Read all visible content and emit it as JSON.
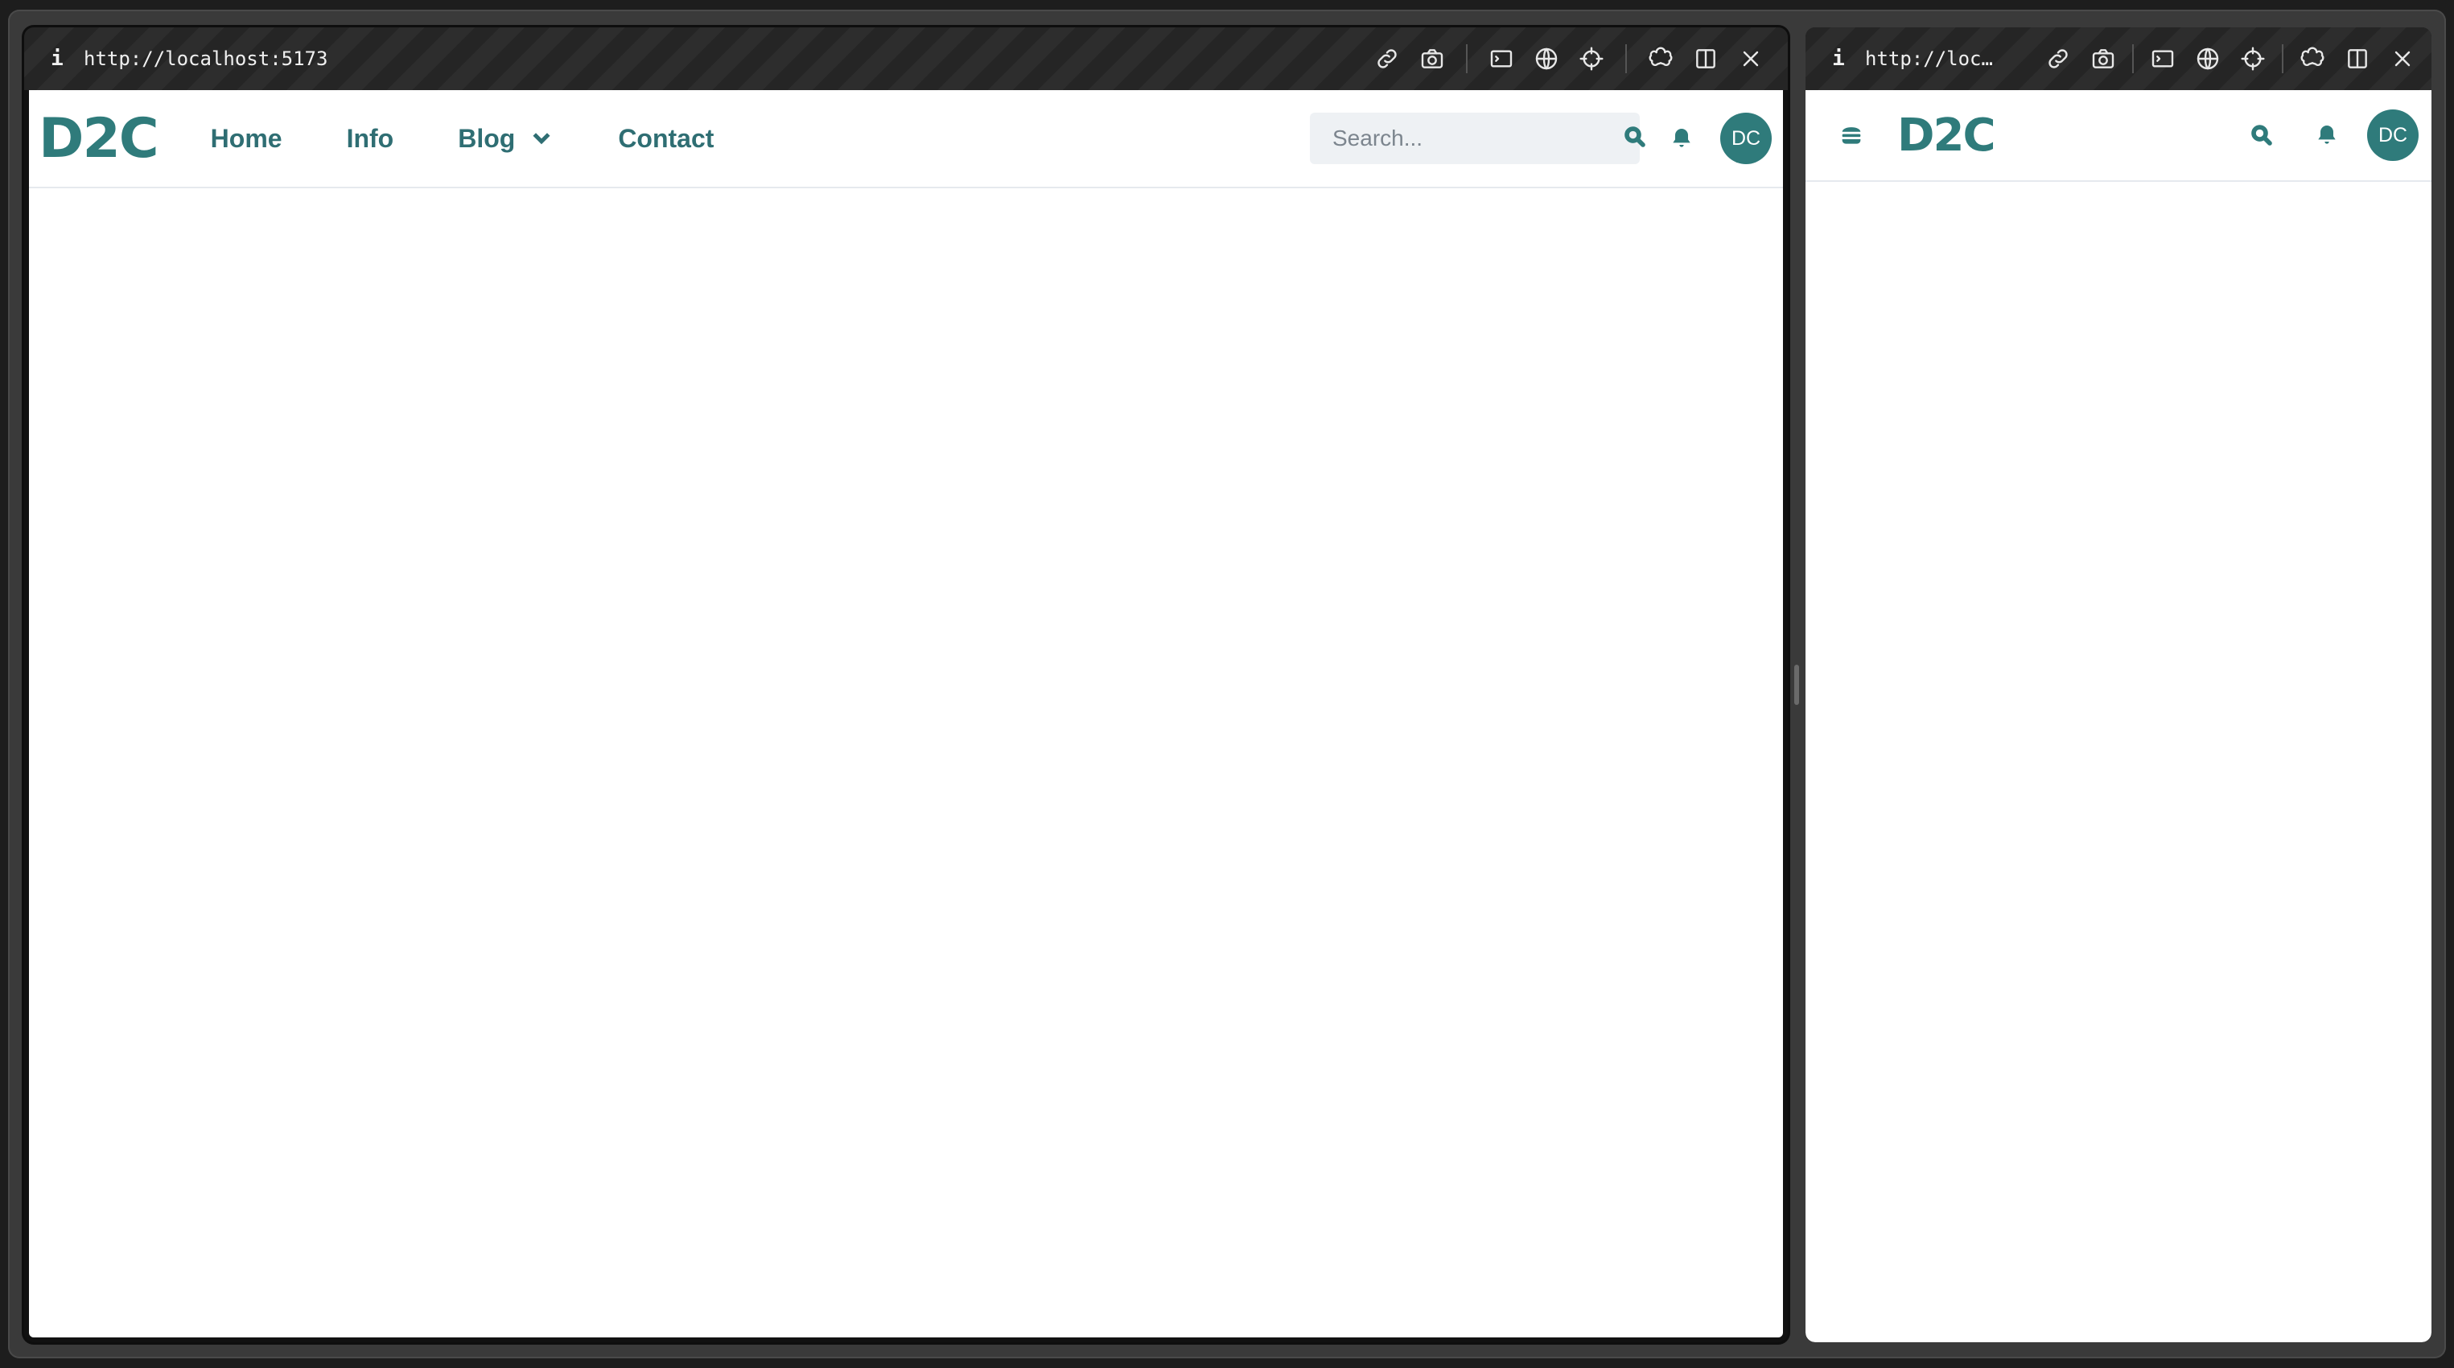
{
  "left_window": {
    "url": "http://localhost:5173",
    "logo": "D2C",
    "nav": [
      {
        "label": "Home"
      },
      {
        "label": "Info"
      },
      {
        "label": "Blog"
      },
      {
        "label": "Contact"
      }
    ],
    "search_placeholder": "Search...",
    "avatar_initials": "DC"
  },
  "right_window": {
    "url": "http://loc…",
    "logo": "D2C",
    "avatar_initials": "DC"
  },
  "colors": {
    "brand": "#2f7b7b",
    "chrome": "#2a2a2a",
    "search_bg": "#eef1f4"
  },
  "toolbar_icons": [
    "link-icon",
    "camera-icon",
    "terminal-icon",
    "globe-icon",
    "crosshair-icon",
    "brain-icon",
    "split-view-icon",
    "close-icon"
  ]
}
